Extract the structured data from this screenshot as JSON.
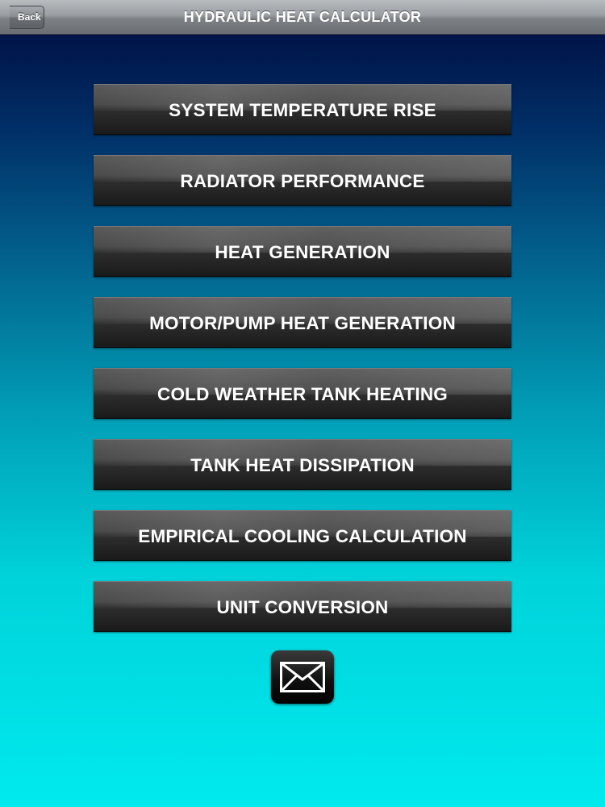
{
  "navbar": {
    "title": "HYDRAULIC HEAT CALCULATOR",
    "back_label": "Back"
  },
  "menu": {
    "items": [
      {
        "label": "SYSTEM TEMPERATURE RISE"
      },
      {
        "label": "RADIATOR PERFORMANCE"
      },
      {
        "label": "HEAT GENERATION"
      },
      {
        "label": "MOTOR/PUMP HEAT GENERATION"
      },
      {
        "label": "COLD WEATHER TANK HEATING"
      },
      {
        "label": "TANK HEAT DISSIPATION"
      },
      {
        "label": "EMPIRICAL COOLING CALCULATION"
      },
      {
        "label": "UNIT CONVERSION"
      }
    ]
  },
  "mail": {
    "icon": "envelope-icon"
  },
  "colors": {
    "background_top": "#000a3c",
    "background_bottom": "#00eaee",
    "button_fill": "#2c2c2c",
    "button_text": "#ffffff"
  }
}
